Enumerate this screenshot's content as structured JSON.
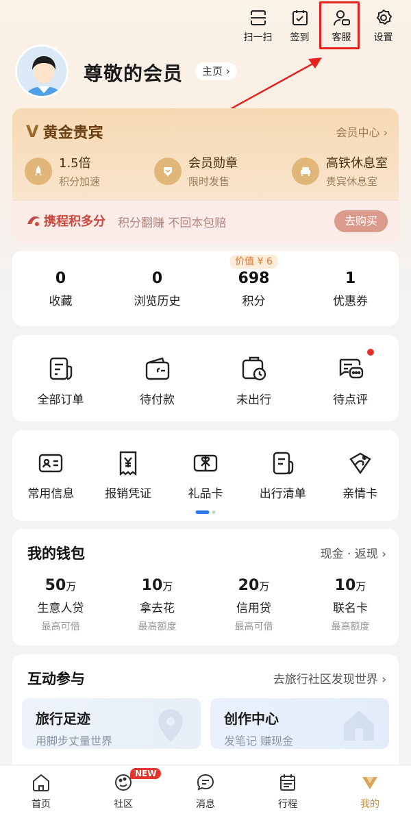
{
  "top_actions": [
    {
      "label": "扫一扫",
      "icon": "scan-icon"
    },
    {
      "label": "签到",
      "icon": "calendar-check-icon"
    },
    {
      "label": "客服",
      "icon": "customer-service-icon"
    },
    {
      "label": "设置",
      "icon": "gear-icon"
    }
  ],
  "profile": {
    "name": "尊敬的会员",
    "homepage": "主页 ›"
  },
  "membership": {
    "level": "黄金贵宾",
    "center_link": "会员中心 ›",
    "perks": [
      {
        "title": "1.5倍",
        "sub": "积分加速",
        "icon": "rocket-icon"
      },
      {
        "title": "会员勋章",
        "sub": "限时发售",
        "icon": "badge-icon"
      },
      {
        "title": "高铁休息室",
        "sub": "贵宾休息室",
        "icon": "lounge-icon"
      }
    ],
    "promo_brand": "携程积多分",
    "promo_slogan": "积分翻赚 不回本包赔",
    "buy_label": "去购买"
  },
  "stats": [
    {
      "value": "0",
      "label": "收藏"
    },
    {
      "value": "0",
      "label": "浏览历史"
    },
    {
      "value": "698",
      "label": "积分",
      "badge": "价值 ¥ 6"
    },
    {
      "value": "1",
      "label": "优惠券"
    }
  ],
  "orders": [
    {
      "label": "全部订单",
      "icon": "order-list-icon"
    },
    {
      "label": "待付款",
      "icon": "wallet-icon"
    },
    {
      "label": "未出行",
      "icon": "luggage-clock-icon"
    },
    {
      "label": "待点评",
      "icon": "comment-icon"
    }
  ],
  "tools": [
    {
      "label": "常用信息",
      "icon": "id-card-icon"
    },
    {
      "label": "报销凭证",
      "icon": "receipt-icon"
    },
    {
      "label": "礼品卡",
      "icon": "gift-card-icon"
    },
    {
      "label": "出行清单",
      "icon": "checklist-icon"
    },
    {
      "label": "亲情卡",
      "icon": "family-card-icon"
    }
  ],
  "wallet": {
    "title": "我的钱包",
    "link": "现金 · 返现 ›",
    "items": [
      {
        "amount": "50",
        "unit": "万",
        "name": "生意人贷",
        "desc": "最高可借"
      },
      {
        "amount": "10",
        "unit": "万",
        "name": "拿去花",
        "desc": "最高额度"
      },
      {
        "amount": "20",
        "unit": "万",
        "name": "信用贷",
        "desc": "最高可借"
      },
      {
        "amount": "10",
        "unit": "万",
        "name": "联名卡",
        "desc": "最高额度"
      }
    ]
  },
  "interact": {
    "title": "互动参与",
    "link": "去旅行社区发现世界 ›",
    "cards": [
      {
        "title": "旅行足迹",
        "sub": "用脚步丈量世界"
      },
      {
        "title": "创作中心",
        "sub": "发笔记 赚现金"
      }
    ]
  },
  "tabs": [
    {
      "label": "首页",
      "icon": "home-icon"
    },
    {
      "label": "社区",
      "icon": "community-icon",
      "badge": "NEW"
    },
    {
      "label": "消息",
      "icon": "message-icon"
    },
    {
      "label": "行程",
      "icon": "itinerary-icon"
    },
    {
      "label": "我的",
      "icon": "my-vip-icon",
      "active": true
    }
  ],
  "colors": {
    "accent_gold": "#c08a3e",
    "highlight_red": "#e4231f",
    "pager_blue": "#2f7bf2"
  }
}
